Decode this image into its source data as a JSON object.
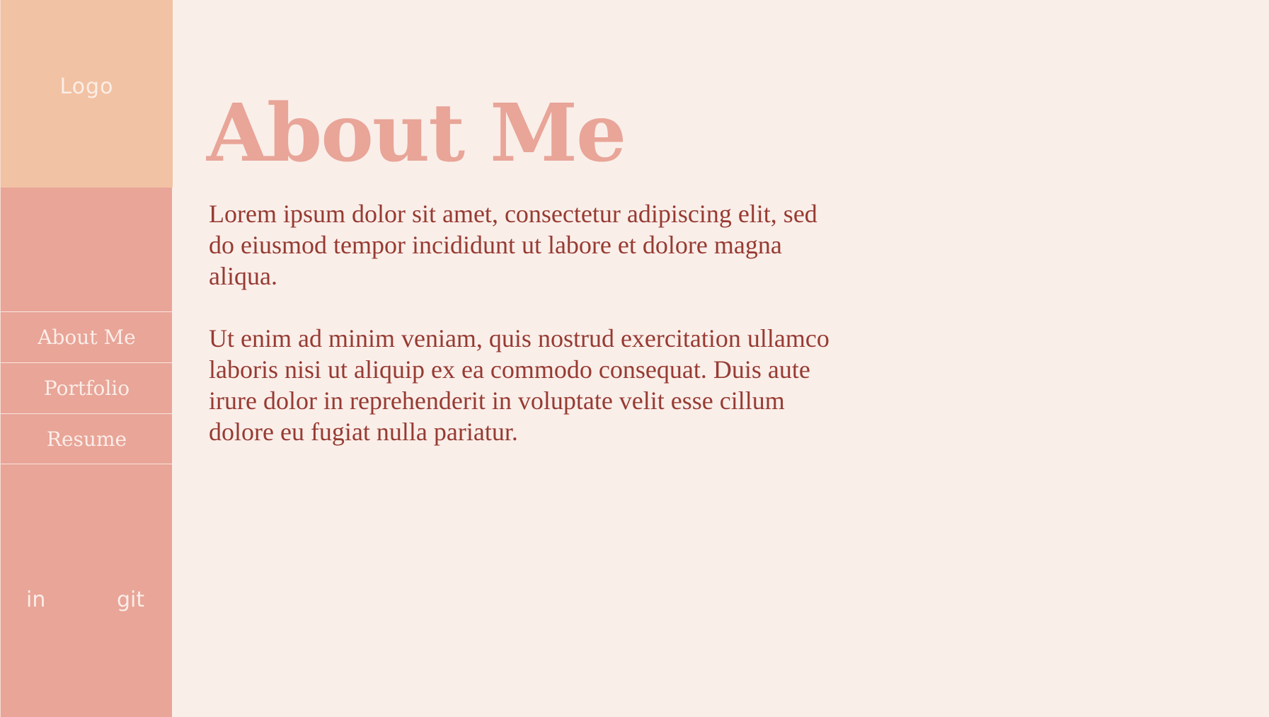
{
  "sidebar": {
    "logo": "Logo",
    "nav": [
      {
        "label": "About Me"
      },
      {
        "label": "Portfolio"
      },
      {
        "label": "Resume"
      }
    ],
    "social": {
      "linkedin": "in",
      "github": "git"
    }
  },
  "main": {
    "title": "About Me",
    "paragraphs": [
      "Lorem ipsum dolor sit amet, consectetur adipiscing elit, sed do eiusmod tempor incididunt ut labore et dolore magna aliqua.",
      "Ut enim ad minim veniam, quis nostrud exercitation ullamco laboris nisi ut aliquip ex ea commodo consequat. Duis aute irure dolor in reprehenderit in voluptate velit esse cillum dolore eu fugiat nulla pariatur."
    ]
  },
  "colors": {
    "background": "#faeee9",
    "sidebar": "#e8a598",
    "logo_block": "#f2c2a4",
    "title": "#e8a598",
    "body_text": "#963b32",
    "sidebar_text": "#fbede8"
  }
}
